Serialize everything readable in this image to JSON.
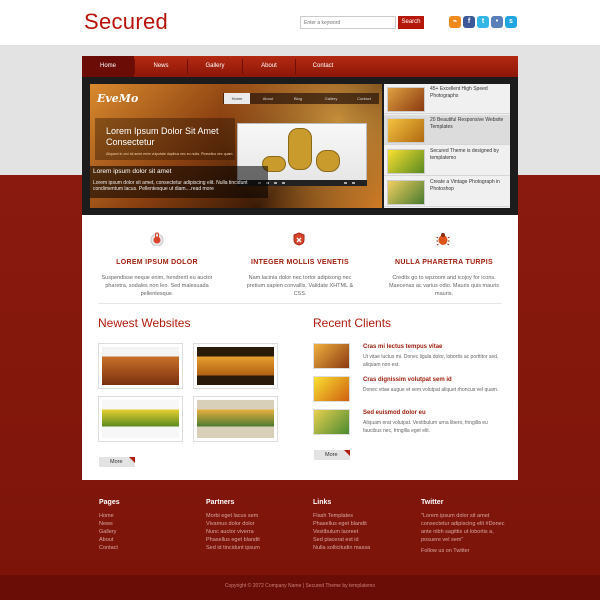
{
  "header": {
    "logo": "Secured",
    "search_placeholder": "Enter a keyword",
    "search_button": "Search"
  },
  "nav": {
    "items": [
      "Home",
      "News",
      "Gallery",
      "About",
      "Contact"
    ]
  },
  "slider": {
    "brand": "EveMo",
    "mini_nav": [
      "Home",
      "About",
      "Blog",
      "Gallery",
      "Contact"
    ],
    "heading": "Lorem Ipsum Dolor Sit Amet Consectetur",
    "small_text": "Aliquam in orci sit amet enim vulputate dapibus nec eu nulla. Phasellus nec quam.",
    "dark_title": "Lorem ipsum dolor sit amet",
    "dark_text": "Lorem ipsum dolor sit amet, consectetur adipiscing elit. Nulla tincidunt condimentum lacus. Pellentesque ut diam....read more"
  },
  "side_list": [
    {
      "text": "45+ Excellent High Speed Photographs"
    },
    {
      "text": "20 Beautiful Responsive Website Templates"
    },
    {
      "text": "Secured Theme is designed by templatemo"
    },
    {
      "text": "Create a Vintage Photograph in Photoshop"
    }
  ],
  "features": [
    {
      "icon": "lock-icon",
      "title": "LOREM IPSUM DOLOR",
      "text": "Suspendisse neque enim, hendrerit eu auctor pharetra, sodales non leo. Sed malesuada pellentesque."
    },
    {
      "icon": "shield-icon",
      "title": "INTEGER MOLLIS VENETIS",
      "text": "Nam lacinia dolor nec tortor adipisong nec pretium sapien convallis. Validate XHTML & CSS."
    },
    {
      "icon": "bug-icon",
      "title": "NULLA PHARETRA TURPIS",
      "text": "Credits go to wpzoom and icojoy for icons. Maecenas ac varius odio. Mauris quis mauris mauris."
    }
  ],
  "websites": {
    "title": "Newest Websites",
    "more": "More"
  },
  "clients": {
    "title": "Recent Clients",
    "more": "More",
    "items": [
      {
        "title": "Cras mi lectus tempus vitae",
        "text": "Ut vitae luctus mi. Donec ligula dolor, lobortis ac porttitor sed, aliquam non est."
      },
      {
        "title": "Cras dignissim volutpat sem id",
        "text": "Donec vitae augue et sem volutpat aliquet rhoncus vel quam."
      },
      {
        "title": "Sed euismod dolor eu",
        "text": "Aliquam erat volutpat. Vestibulum urna libero, fringilla eu faucibus nec, fringilla eget elit."
      }
    ]
  },
  "footer": {
    "pages": {
      "title": "Pages",
      "links": [
        "Home",
        "News",
        "Gallery",
        "About",
        "Contact"
      ]
    },
    "partners": {
      "title": "Partners",
      "links": [
        "Morbi eget lacus sem",
        "Vivamus dolor dolor",
        "Nunc auctor viverra",
        "Phasellus eget blandit",
        "Sed id tincidunt ipsum"
      ]
    },
    "links": {
      "title": "Links",
      "links": [
        "Flash Templates",
        "Phasellus eget blandit",
        "Vestibulum laoreet",
        "Sed placerat est id",
        "Nulla sollicitudin massa"
      ]
    },
    "twitter": {
      "title": "Twitter",
      "text": "\"Lorem ipsum dolor sit amet consectetur adipiscing elit #Donec ante nibh sagittis ut lobortis a, posuere vel sem\"",
      "follow": "Follow us on Twitter"
    },
    "copyright": "Copyright © 2072 Company Name | Secured Theme by templatemo"
  },
  "colors": {
    "brand_red": "#b8120a",
    "dark_red": "#7a1108"
  }
}
